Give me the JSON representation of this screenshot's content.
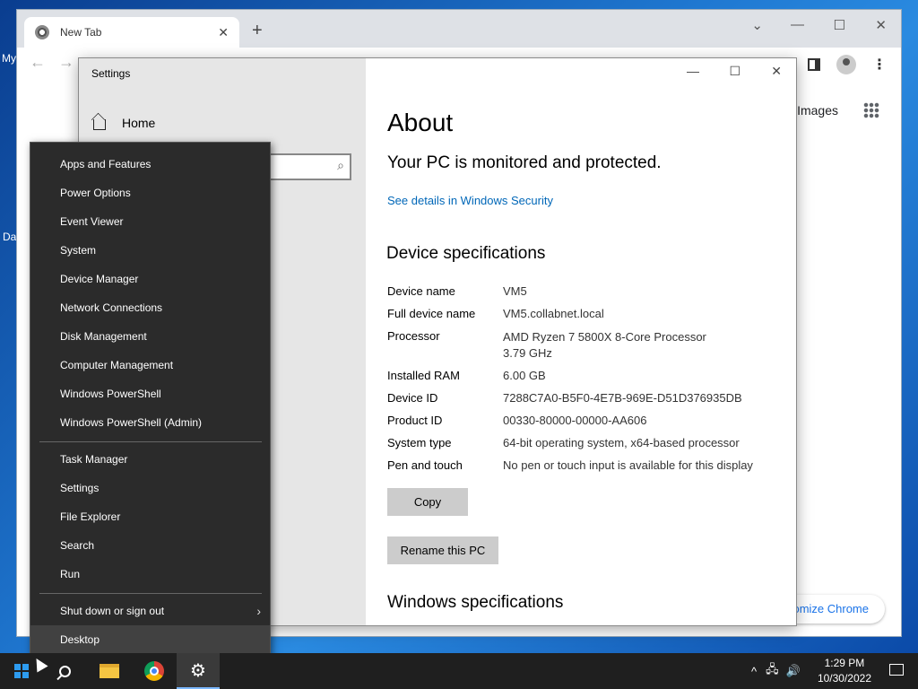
{
  "desktop": {
    "icon_labels": [
      "My",
      "Da"
    ]
  },
  "chrome": {
    "tab_title": "New Tab",
    "images_link": "Images",
    "customize_button": "omize Chrome"
  },
  "settings": {
    "window_title": "Settings",
    "home_label": "Home",
    "page_title": "About",
    "protection_status": "Your PC is monitored and protected.",
    "security_link": "See details in Windows Security",
    "device_specs_heading": "Device specifications",
    "specs": [
      {
        "label": "Device name",
        "value": "VM5"
      },
      {
        "label": "Full device name",
        "value": "VM5.collabnet.local"
      },
      {
        "label": "Processor",
        "value": "AMD Ryzen 7 5800X 8-Core Processor",
        "value2": "3.79 GHz"
      },
      {
        "label": "Installed RAM",
        "value": "6.00 GB"
      },
      {
        "label": "Device ID",
        "value": "7288C7A0-B5F0-4E7B-969E-D51D376935DB"
      },
      {
        "label": "Product ID",
        "value": "00330-80000-00000-AA606"
      },
      {
        "label": "System type",
        "value": "64-bit operating system, x64-based processor"
      },
      {
        "label": "Pen and touch",
        "value": "No pen or touch input is available for this display"
      }
    ],
    "copy_button": "Copy",
    "rename_button": "Rename this PC",
    "windows_specs_heading": "Windows specifications"
  },
  "context_menu": {
    "items": [
      "Apps and Features",
      "Power Options",
      "Event Viewer",
      "System",
      "Device Manager",
      "Network Connections",
      "Disk Management",
      "Computer Management",
      "Windows PowerShell",
      "Windows PowerShell (Admin)",
      "Task Manager",
      "Settings",
      "File Explorer",
      "Search",
      "Run",
      "Shut down or sign out",
      "Desktop"
    ]
  },
  "taskbar": {
    "time": "1:29 PM",
    "date": "10/30/2022"
  }
}
